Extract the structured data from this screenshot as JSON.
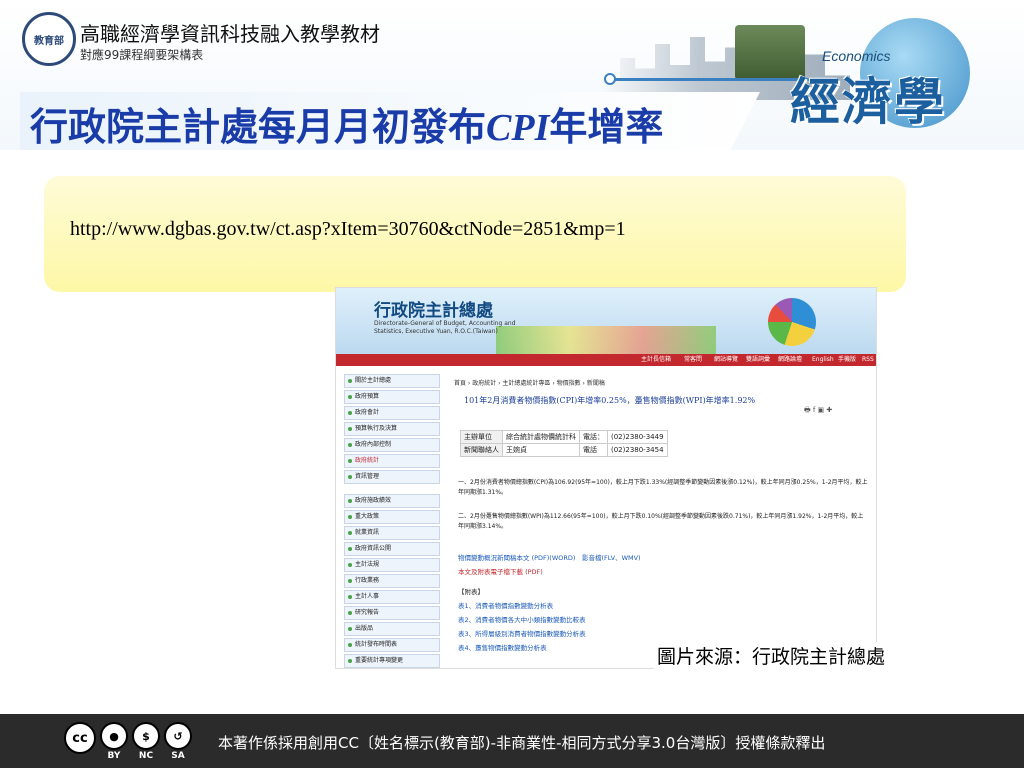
{
  "header": {
    "series_title": "高職經濟學資訊科技融入教學教材",
    "series_subtitle": "對應99課程綱要架構表",
    "economics_word": "Economics",
    "economics_big": "經濟學",
    "logo_text": "教育部"
  },
  "slide": {
    "title_prefix": "行政院主計處每月月初發布",
    "title_cpi": "CPI",
    "title_suffix": "年增率",
    "url": "http://www.dgbas.gov.tw/ct.asp?xItem=30760&ctNode=2851&mp=1",
    "caption": "圖片來源：行政院主計總處"
  },
  "screenshot": {
    "site_title": "行政院主計總處",
    "site_subtitle": "Directorate-General of Budget, Accounting and Statistics, Executive Yuan, R.O.C.(Taiwan)",
    "nav": [
      "主計長信箱",
      "常客問",
      "網站導覽",
      "雙語詞彙",
      "網路論壇",
      "English",
      "手機版",
      "RSS"
    ],
    "sidebar_group1": [
      "關於主計總處",
      "政府預算",
      "政府會計",
      "預算執行及決算",
      "政府內部控制",
      "政府統計",
      "資訊管理"
    ],
    "sidebar_group2": [
      "政府施政績效",
      "重大政策",
      "就業資訊",
      "政府資訊公開",
      "主計法規",
      "行政業務",
      "主計人事",
      "研究報告",
      "出版品",
      "統計發布時間表",
      "重要統計專項變更"
    ],
    "breadcrumb": "首頁 › 政府統計 › 主計總處統計專區 › 物價指數 › 新聞稿",
    "news_title": "101年2月消費者物價指數(CPI)年增率0.25%，躉售物價指數(WPI)年增率1.92%",
    "contact": [
      {
        "k1": "主辦單位",
        "v1": "綜合統計處物價統計科",
        "k2": "電話：",
        "v2": "(02)2380-3449"
      },
      {
        "k1": "新聞聯絡人",
        "v1": "王婉貞",
        "k2": "電話",
        "v2": "(02)2380-3454"
      }
    ],
    "para1": "一、2月份消費者物價總指數(CPI)為106.92(95年=100)，較上月下跌1.33%(經調整季節變動因素後漲0.12%)，較上年同月漲0.25%，1-2月平均，較上年同期漲1.31%。",
    "para2": "二、2月份躉售物價總指數(WPI)為112.66(95年=100)，較上月下跌0.10%(經調整季節變動因素後跌0.71%)，較上年同月漲1.92%，1-2月平均，較上年同期漲3.14%。",
    "links1": "物價變動概況新聞稿本文 (PDF)(WORD)　影音檔(FLV、WMV)",
    "links2": "本文及附表電子檔下載 (PDF)",
    "appendix_head": "【附表】",
    "appendix": [
      "表1、消費者物價指數變動分析表",
      "表2、消費者物價各大中小類指數變動比較表",
      "表3、所得層級別消費者物價指數變動分析表",
      "表4、躉售物價指數變動分析表"
    ]
  },
  "footer": {
    "license_text": "本著作係採用創用CC〔姓名標示(教育部)-非商業性-相同方式分享3.0台灣版〕授權條款釋出",
    "cc_labels": [
      "BY",
      "NC",
      "SA"
    ]
  }
}
